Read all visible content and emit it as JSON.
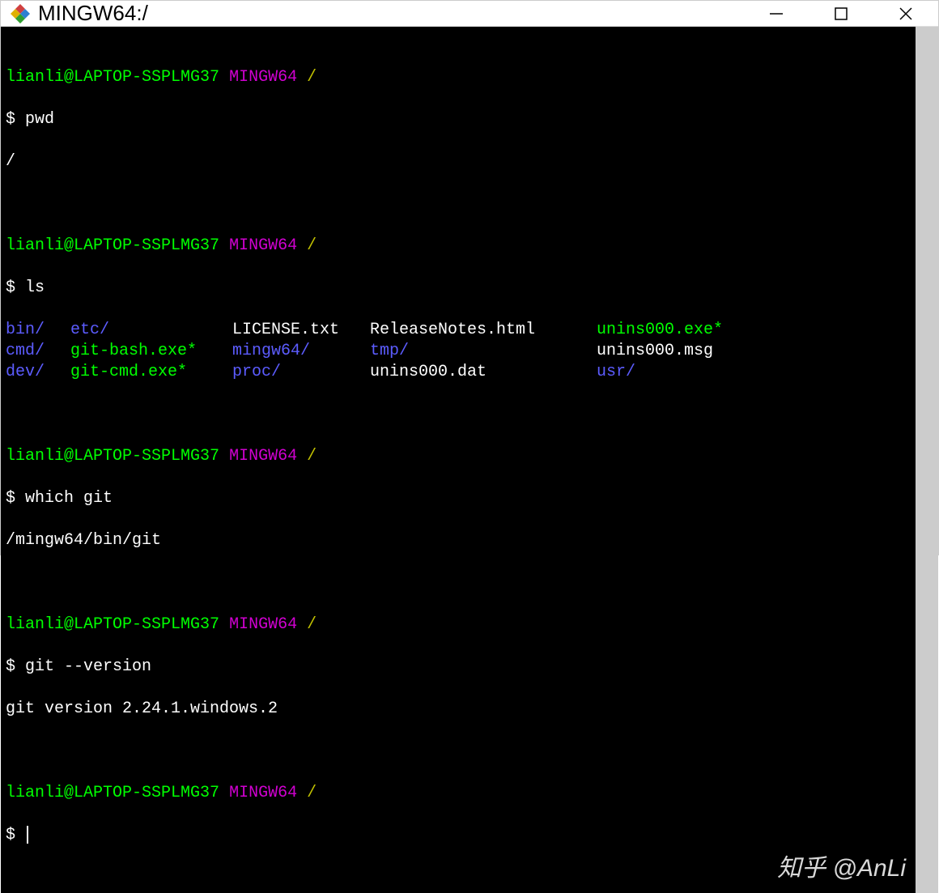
{
  "window": {
    "title": "MINGW64:/"
  },
  "prompt": {
    "user": "lianli@LAPTOP-SSPLMG37",
    "env": "MINGW64",
    "path": "/",
    "symbol": "$"
  },
  "block1": {
    "command": "pwd",
    "output": "/"
  },
  "block2": {
    "command": "ls",
    "ls": {
      "c1r1": "bin/",
      "c1r2": "cmd/",
      "c1r3": "dev/",
      "c2r1": "etc/",
      "c2r2": "git-bash.exe*",
      "c2r3": "git-cmd.exe*",
      "c3r1": "LICENSE.txt",
      "c3r2": "mingw64/",
      "c3r3": "proc/",
      "c4r1": "ReleaseNotes.html",
      "c4r2": "tmp/",
      "c4r3": "unins000.dat",
      "c5r1": "unins000.exe*",
      "c5r2": "unins000.msg",
      "c5r3": "usr/"
    }
  },
  "block3": {
    "command": "which git",
    "output": "/mingw64/bin/git"
  },
  "block4": {
    "command": "git --version",
    "output": "git version 2.24.1.windows.2"
  },
  "watermark": "知乎 @AnLi"
}
